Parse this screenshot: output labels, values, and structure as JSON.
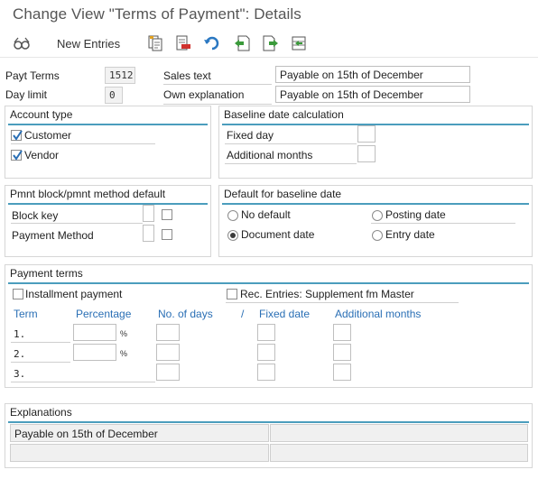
{
  "title": "Change View \"Terms of Payment\": Details",
  "toolbar": {
    "new_entries_label": "New Entries",
    "icons": [
      "glasses-icon",
      "copy-icon",
      "delete-icon",
      "undo-icon",
      "previous-entry-icon",
      "next-entry-icon",
      "select-all-icon"
    ]
  },
  "header": {
    "payt_terms_label": "Payt Terms",
    "payt_terms_value": "1512",
    "day_limit_label": "Day limit",
    "day_limit_value": "0",
    "sales_text_label": "Sales text",
    "sales_text_value": "Payable on 15th of December",
    "own_explanation_label": "Own explanation",
    "own_explanation_value": "Payable on 15th of December"
  },
  "account_type": {
    "title": "Account type",
    "customer_label": "Customer",
    "customer_checked": true,
    "vendor_label": "Vendor",
    "vendor_checked": true
  },
  "baseline_calc": {
    "title": "Baseline date calculation",
    "fixed_day_label": "Fixed day",
    "fixed_day_value": "",
    "additional_months_label": "Additional months",
    "additional_months_value": ""
  },
  "pmnt_block": {
    "title": "Pmnt block/pmnt method default",
    "block_key_label": "Block key",
    "payment_method_label": "Payment Method"
  },
  "default_baseline": {
    "title": "Default for baseline date",
    "no_default_label": "No default",
    "posting_date_label": "Posting date",
    "document_date_label": "Document date",
    "entry_date_label": "Entry date",
    "selected": "document_date"
  },
  "payment_terms": {
    "title": "Payment terms",
    "installment_label": "Installment payment",
    "installment_checked": false,
    "rec_entries_label": "Rec. Entries: Supplement fm Master",
    "rec_entries_checked": false,
    "col_term": "Term",
    "col_percentage": "Percentage",
    "col_no_of_days": "No. of days",
    "col_slash": "/",
    "col_fixed_date": "Fixed date",
    "col_additional_months": "Additional months",
    "rows": [
      {
        "term": "1.",
        "pct_symbol": "%"
      },
      {
        "term": "2.",
        "pct_symbol": "%"
      },
      {
        "term": "3.",
        "pct_symbol": ""
      }
    ]
  },
  "explanations": {
    "title": "Explanations",
    "lines": [
      "Payable on 15th of December",
      "",
      "",
      ""
    ]
  }
}
